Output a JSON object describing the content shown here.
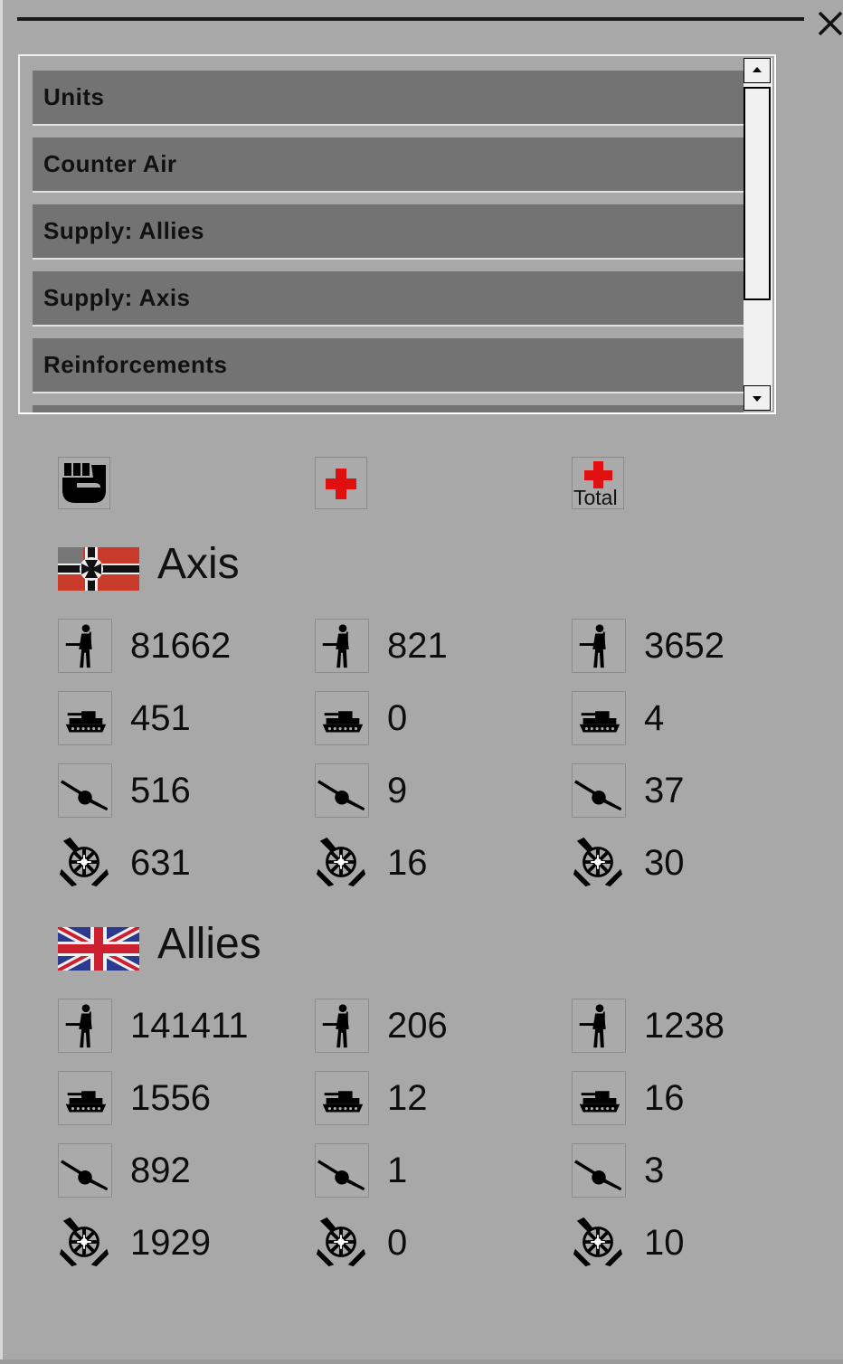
{
  "window": {
    "close_icon": "close-icon"
  },
  "list": {
    "items": [
      {
        "label": "Units"
      },
      {
        "label": "Counter Air"
      },
      {
        "label": "Supply: Allies"
      },
      {
        "label": "Supply: Axis"
      },
      {
        "label": "Reinforcements"
      }
    ]
  },
  "columns": [
    {
      "icon": "strength-fist-icon"
    },
    {
      "icon": "losses-red-cross-icon"
    },
    {
      "icon": "total-losses-icon",
      "label": "Total"
    }
  ],
  "sides": [
    {
      "name": "Axis",
      "flag": "german-war-flag-icon",
      "rows": [
        {
          "type": "infantry",
          "icon": "infantry-icon",
          "values": [
            "81662",
            "821",
            "3652"
          ]
        },
        {
          "type": "tank",
          "icon": "tank-icon",
          "values": [
            "451",
            "0",
            "4"
          ]
        },
        {
          "type": "artillery",
          "icon": "artillery-icon",
          "values": [
            "516",
            "9",
            "37"
          ]
        },
        {
          "type": "anti-air",
          "icon": "anti-aircraft-icon",
          "values": [
            "631",
            "16",
            "30"
          ]
        }
      ]
    },
    {
      "name": "Allies",
      "flag": "union-jack-flag-icon",
      "rows": [
        {
          "type": "infantry",
          "icon": "infantry-icon",
          "values": [
            "141411",
            "206",
            "1238"
          ]
        },
        {
          "type": "tank",
          "icon": "tank-icon",
          "values": [
            "1556",
            "12",
            "16"
          ]
        },
        {
          "type": "artillery",
          "icon": "artillery-icon",
          "values": [
            "892",
            "1",
            "3"
          ]
        },
        {
          "type": "anti-air",
          "icon": "anti-aircraft-icon",
          "values": [
            "1929",
            "0",
            "10"
          ]
        }
      ]
    }
  ],
  "colors": {
    "background": "#a8a8a8",
    "list_item": "#737373",
    "red_cross": "#e01010"
  }
}
